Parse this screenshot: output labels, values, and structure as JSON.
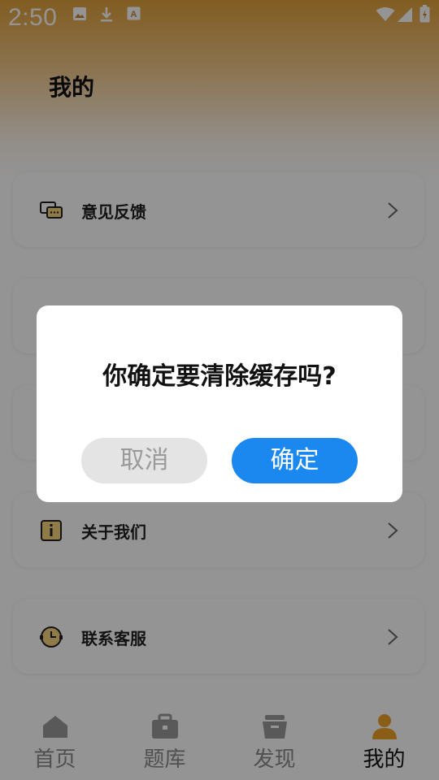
{
  "status_bar": {
    "time": "2:50",
    "left_icons": [
      "image-icon",
      "download-icon",
      "a-box-icon"
    ],
    "right_icons": [
      "wifi-icon",
      "signal-icon",
      "battery-icon"
    ]
  },
  "page": {
    "title": "我的"
  },
  "menu": {
    "items": [
      {
        "label": "意见反馈",
        "icon": "feedback-chat-icon"
      },
      {
        "label": "关于我们",
        "icon": "info-icon"
      },
      {
        "label": "联系客服",
        "icon": "clock-service-icon"
      }
    ]
  },
  "dialog": {
    "message": "你确定要清除缓存吗?",
    "cancel_label": "取消",
    "confirm_label": "确定"
  },
  "tabbar": {
    "tabs": [
      {
        "label": "首页",
        "icon": "home-icon"
      },
      {
        "label": "题库",
        "icon": "briefcase-icon"
      },
      {
        "label": "发现",
        "icon": "basket-icon"
      },
      {
        "label": "我的",
        "icon": "person-icon"
      }
    ],
    "active_index": 3
  },
  "colors": {
    "accent": "#1a88ef",
    "header_gradient_top": "#e0a03a",
    "active_tab_icon": "#f0a22a",
    "overlay": "rgba(0,0,0,0.42)"
  }
}
